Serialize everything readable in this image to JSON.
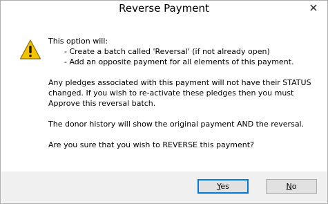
{
  "window": {
    "title": "Reverse Payment",
    "close_glyph": "✕"
  },
  "icon": {
    "name": "warning-icon",
    "fill": "#f5c300",
    "stroke": "#8a6a00",
    "mark": "!"
  },
  "message": {
    "intro": "This option will:",
    "bullet1": "- Create a batch called 'Reversal' (if not already open)",
    "bullet2": "- Add an opposite payment for all elements of this payment.",
    "pledge1": "Any pledges associated with this payment will not have their STATUS",
    "pledge2": "changed.  If you wish to re-activate these pledges then you must",
    "pledge3": "Approve this reversal batch.",
    "history": "The donor history will show the original payment AND the reversal.",
    "confirm": "Are you sure that you wish to REVERSE this payment?"
  },
  "buttons": {
    "yes": {
      "mnemonic": "Y",
      "rest": "es"
    },
    "no": {
      "mnemonic": "N",
      "rest": "o"
    }
  }
}
